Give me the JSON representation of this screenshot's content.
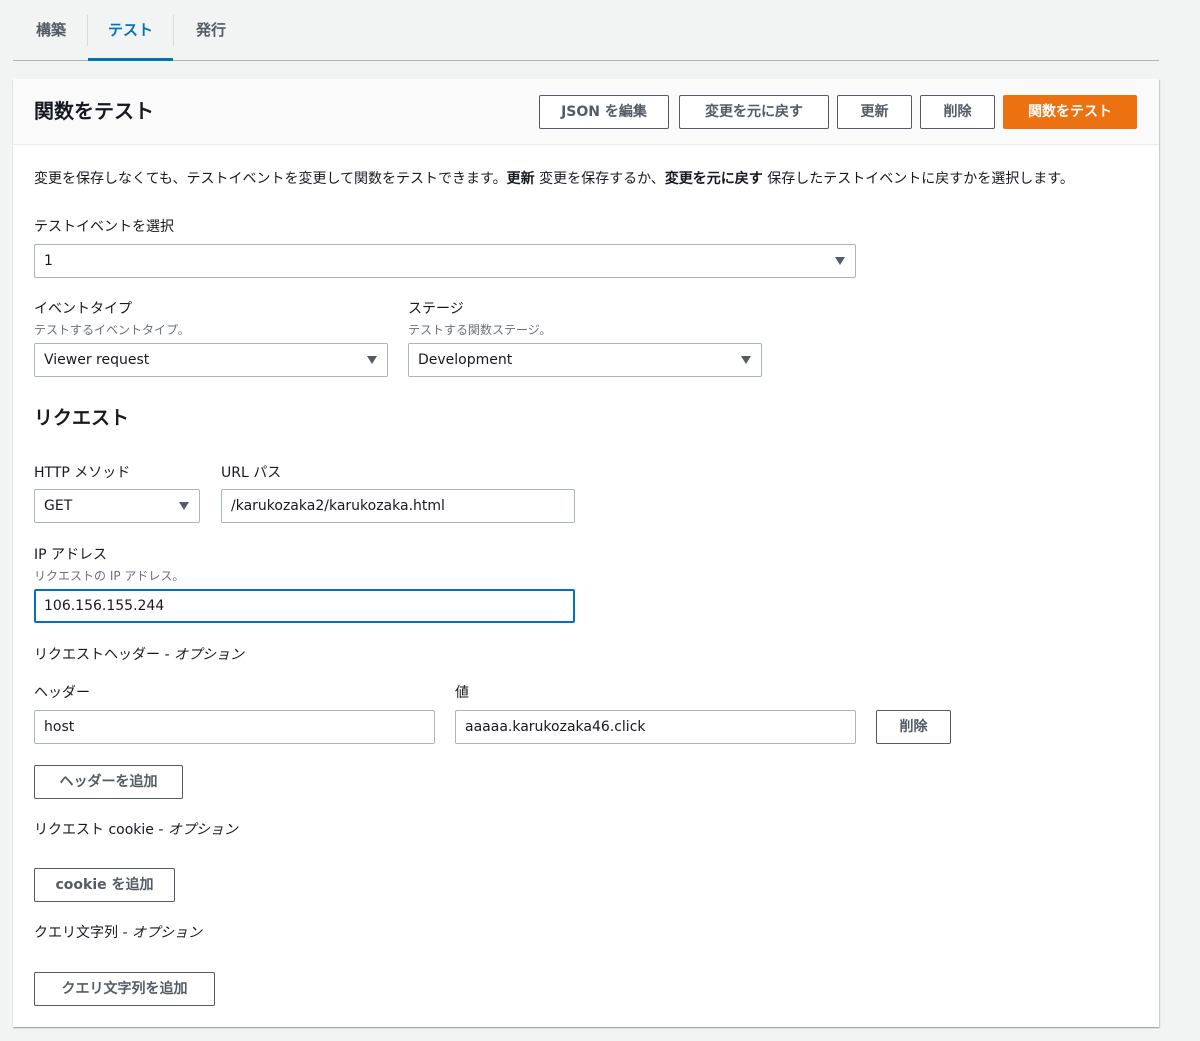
{
  "tabs": [
    {
      "label": "構築"
    },
    {
      "label": "テスト"
    },
    {
      "label": "発行"
    }
  ],
  "active_tab": "テスト",
  "panel": {
    "title": "関数をテスト",
    "buttons": {
      "edit_json": "JSON を編集",
      "revert": "変更を元に戻す",
      "update": "更新",
      "delete": "削除",
      "test": "関数をテスト"
    }
  },
  "description": {
    "part1": "変更を保存しなくても、テストイベントを変更して関数をテストできます。",
    "bold1": "更新",
    "part2": " 変更を保存するか、",
    "bold2": "変更を元に戻す",
    "part3": " 保存したテストイベントに戻すかを選択します。"
  },
  "test_event": {
    "label": "テストイベントを選択",
    "value": "1"
  },
  "event_type": {
    "label": "イベントタイプ",
    "hint": "テストするイベントタイプ。",
    "value": "Viewer request"
  },
  "stage": {
    "label": "ステージ",
    "hint": "テストする関数ステージ。",
    "value": "Development"
  },
  "request": {
    "heading": "リクエスト",
    "http_method": {
      "label": "HTTP メソッド",
      "value": "GET"
    },
    "url_path": {
      "label": "URL パス",
      "value": "/karukozaka2/karukozaka.html"
    },
    "ip_address": {
      "label": "IP アドレス",
      "hint": "リクエストの IP アドレス。",
      "value": "106.156.155.244"
    },
    "headers": {
      "title": "リクエストヘッダー",
      "optional": " - オプション",
      "header_label": "ヘッダー",
      "value_label": "値",
      "rows": [
        {
          "header": "host",
          "value": "aaaaa.karukozaka46.click",
          "remove": "削除"
        }
      ],
      "add_button": "ヘッダーを追加"
    },
    "cookies": {
      "title": "リクエスト cookie",
      "optional": " - オプション",
      "add_button": "cookie を追加"
    },
    "query": {
      "title": "クエリ文字列",
      "optional": " - オプション",
      "add_button": "クエリ文字列を追加"
    }
  },
  "colors": {
    "accent": "#0073bb",
    "primary_button": "#ec7211",
    "panel_header": "#fafafa"
  }
}
